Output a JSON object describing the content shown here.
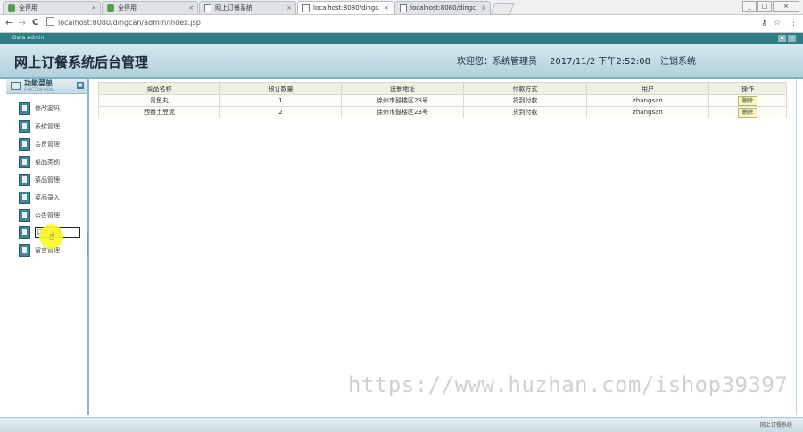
{
  "browser": {
    "tabs": [
      {
        "label": "全停用",
        "close": "×",
        "active": false
      },
      {
        "label": "全停用",
        "close": "×",
        "active": false
      },
      {
        "label": "网上订餐系统",
        "close": "×",
        "active": false
      },
      {
        "label": "localhost:8080/dingcan",
        "close": "×",
        "active": true
      },
      {
        "label": "localhost:8080/dingcan",
        "close": "×",
        "active": false
      }
    ],
    "window_controls": [
      "_",
      "□",
      "×"
    ],
    "url": "localhost:8080/dingcan/admin/index.jsp",
    "back": "←",
    "forward": "→",
    "reload": "C",
    "key_icon": "⚷",
    "star_icon": "☆",
    "menu_icon": "⋮"
  },
  "app": {
    "window_title": "Data Admin",
    "site_title": "网上订餐系统后台管理",
    "welcome": "欢迎您：系统管理员",
    "datetime": "2017/11/2 下午2:52:08",
    "logout": "注销系统",
    "footer": "网上订餐系统"
  },
  "sidebar": {
    "title": "功能菜单",
    "subtitle": "FUNCTION MENU",
    "collapse_icon": "▣",
    "items": [
      {
        "label": "修改密码"
      },
      {
        "label": "系统管理"
      },
      {
        "label": "会员管理"
      },
      {
        "label": "菜品类别"
      },
      {
        "label": "菜品管理"
      },
      {
        "label": "菜品录入"
      },
      {
        "label": "公告管理"
      },
      {
        "label": "订单管理"
      },
      {
        "label": "留言管理"
      }
    ]
  },
  "orders": {
    "headers": [
      "菜品名称",
      "预订数量",
      "送餐地址",
      "付款方式",
      "用户",
      "操作"
    ],
    "rows": [
      {
        "name": "青鱼丸",
        "qty": "1",
        "address": "徐州市鼓楼区23号",
        "payment": "货到付款",
        "user": "zhangsan",
        "action": "删除"
      },
      {
        "name": "西番土豆泥",
        "qty": "2",
        "address": "徐州市鼓楼区23号",
        "payment": "货到付款",
        "user": "zhangsan",
        "action": "删除"
      }
    ]
  },
  "watermark": "https://www.huzhan.com/ishop39397"
}
